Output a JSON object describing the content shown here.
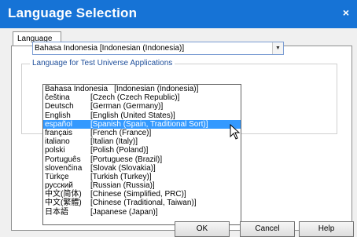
{
  "window": {
    "title": "Language Selection",
    "close_glyph": "×"
  },
  "tab": {
    "label": "Language"
  },
  "group": {
    "label": "Language for Test Universe Applications"
  },
  "combo": {
    "value": "Bahasa Indonesia     [Indonesian (Indonesia)]",
    "arrow": "▼"
  },
  "languages": [
    {
      "native": "Bahasa Indonesia",
      "english": "[Indonesian (Indonesia)]"
    },
    {
      "native": "čeština",
      "english": "[Czech (Czech Republic)]"
    },
    {
      "native": "Deutsch",
      "english": "[German (Germany)]"
    },
    {
      "native": "English",
      "english": "[English (United States)]"
    },
    {
      "native": "español",
      "english": "[Spanish (Spain, Traditional Sort)]"
    },
    {
      "native": "français",
      "english": "[French (France)]"
    },
    {
      "native": "italiano",
      "english": "[Italian (Italy)]"
    },
    {
      "native": "polski",
      "english": "[Polish (Poland)]"
    },
    {
      "native": "Português",
      "english": "[Portuguese (Brazil)]"
    },
    {
      "native": "slovenčina",
      "english": "[Slovak (Slovakia)]"
    },
    {
      "native": "Türkçe",
      "english": "[Turkish (Turkey)]"
    },
    {
      "native": "русский",
      "english": "[Russian (Russia)]"
    },
    {
      "native": "中文(简体)",
      "english": "[Chinese (Simplified, PRC)]"
    },
    {
      "native": "中文(繁體)",
      "english": "[Chinese (Traditional, Taiwan)]"
    },
    {
      "native": "日本語",
      "english": "[Japanese (Japan)]"
    }
  ],
  "selected_language": "español",
  "buttons": {
    "ok": "OK",
    "cancel": "Cancel",
    "help": "Help"
  },
  "colors": {
    "titlebar": "#1673d6",
    "selection": "#3399ff",
    "group_label": "#1e4e9a"
  }
}
